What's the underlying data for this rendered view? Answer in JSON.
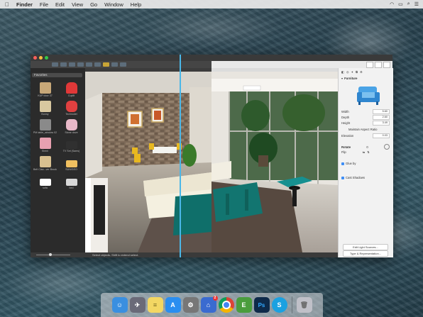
{
  "menubar": {
    "apple": "",
    "items": [
      "Finder",
      "File",
      "Edit",
      "View",
      "Go",
      "Window",
      "Help"
    ]
  },
  "sidebar": {
    "category": "Favorites",
    "items": [
      {
        "label": "KUP door 37",
        "color": "#c8a878"
      },
      {
        "label": "Cuplit",
        "color": "#e03838"
      },
      {
        "label": "Bunny",
        "color": "#d8c8a0"
      },
      {
        "label": "Technodel",
        "color": "#e04040"
      },
      {
        "label": "PM table_window 02",
        "color": "#8a8a8a"
      },
      {
        "label": "Stone dove",
        "color": "#e8b8c8"
      },
      {
        "label": "Sheni",
        "color": "#e8a0b0"
      },
      {
        "label": "TV Set (Sams)",
        "color": "#303030"
      },
      {
        "label": "Belt Ciao...ver Brook",
        "color": "#d8c090"
      },
      {
        "label": "SUN/GEO",
        "color": "#f0c060"
      },
      {
        "label": "sofa",
        "color": "#ffffff"
      },
      {
        "label": "bed",
        "color": "#d8d8d8"
      }
    ]
  },
  "status": "Select objects. Shift to extend select.",
  "inspector": {
    "section": "Furniture",
    "width_label": "Width",
    "width": "5.60",
    "depth_label": "Depth",
    "depth": "2.60",
    "height_label": "Height",
    "height": "3.49",
    "ratio_label": "Maintain Aspect Ratio",
    "elevation_label": "Elevation",
    "elevation": "0.03",
    "rotate_label": "Rotate",
    "rotate_value": "0",
    "flip_label": "Flip",
    "glue_label": "Glue by",
    "shadows_label": "Cast Shadows",
    "light_btn": "Edit Light Sources...",
    "type_btn": "Type & Representation..."
  },
  "dock": [
    {
      "name": "finder",
      "color": "#3a8fe0"
    },
    {
      "name": "launchpad",
      "color": "#6a6a78"
    },
    {
      "name": "notes",
      "color": "#f3d763"
    },
    {
      "name": "app-store",
      "color": "#2a8ef0"
    },
    {
      "name": "system-preferences",
      "color": "#777777"
    },
    {
      "name": "live-home-3d",
      "color": "#3a6bd0"
    },
    {
      "name": "chrome",
      "color": "#e8e8e8"
    },
    {
      "name": "evernote",
      "color": "#4a9d3d"
    },
    {
      "name": "photoshop",
      "color": "#0e2a4a"
    },
    {
      "name": "skype",
      "color": "#1aa1e1"
    },
    {
      "name": "trash",
      "color": "#c0c0c8"
    }
  ],
  "dock_badge": "2",
  "dock_ps_label": "Ps",
  "dock_skype_label": "S",
  "colors": {
    "divider": "#4ab7e8",
    "accent": "#3f8ef5"
  }
}
